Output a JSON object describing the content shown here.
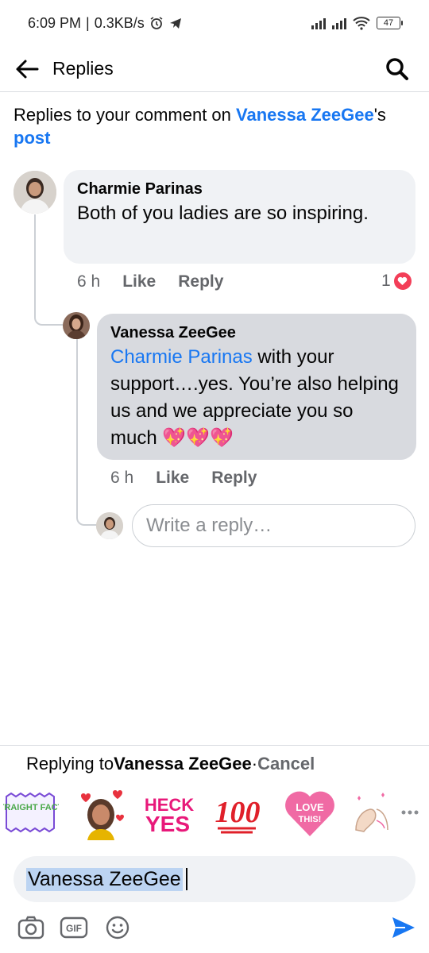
{
  "status_bar": {
    "time": "6:09 PM",
    "speed": "0.3KB/s",
    "battery": "47"
  },
  "header": {
    "title": "Replies"
  },
  "context": {
    "prefix": "Replies to your comment on ",
    "name": "Vanessa ZeeGee",
    "middle": "'s ",
    "post": "post"
  },
  "comment": {
    "author": "Charmie Parinas",
    "text": "Both of  you ladies are so inspiring.",
    "time": "6 h",
    "like": "Like",
    "reply": "Reply",
    "reaction_count": "1"
  },
  "reply": {
    "author": "Vanessa ZeeGee",
    "mention": "Charmie Parinas",
    "text": " with your support….yes. You’re also helping us and we appreciate you so much 💖💖💖",
    "time": "6 h",
    "like": "Like",
    "reply": "Reply"
  },
  "reply_field": {
    "placeholder": "Write a reply…"
  },
  "composer": {
    "replying_prefix": "Replying to ",
    "replying_to": "Vanessa ZeeGee",
    "separator": " · ",
    "cancel": "Cancel",
    "input_value": "Vanessa ZeeGee",
    "stickers": {
      "straight_facts": "STRAIGHT FACTS",
      "heck_yes_1": "HECK",
      "heck_yes_2": "YES",
      "hundred": "100",
      "love_this_1": "LOVE",
      "love_this_2": "THIS!"
    }
  },
  "colors": {
    "accent": "#1877f2",
    "bubble": "#f0f2f5",
    "bubble_selected": "#d8dadf",
    "heart": "#f33e58",
    "secondary_text": "#65676b"
  }
}
